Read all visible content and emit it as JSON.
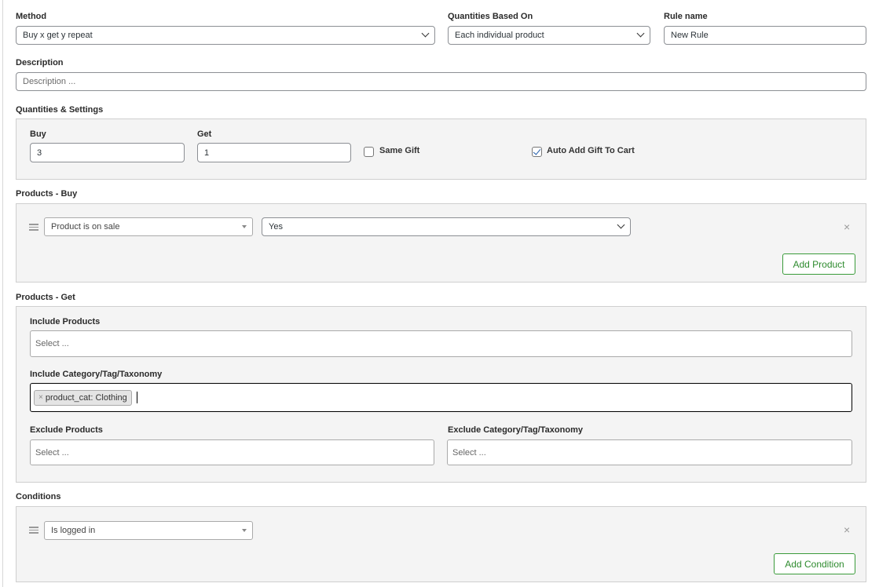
{
  "method": {
    "label": "Method",
    "value": "Buy x get y repeat"
  },
  "quantities_based_on": {
    "label": "Quantities Based On",
    "value": "Each individual product"
  },
  "rule_name": {
    "label": "Rule name",
    "value": "New Rule"
  },
  "description": {
    "label": "Description",
    "placeholder": "Description ..."
  },
  "quantities_settings": {
    "label": "Quantities & Settings",
    "buy_label": "Buy",
    "buy_value": "3",
    "get_label": "Get",
    "get_value": "1",
    "same_gift_label": "Same Gift",
    "same_gift_checked": false,
    "auto_add_label": "Auto Add Gift To Cart",
    "auto_add_checked": true
  },
  "products_buy": {
    "label": "Products - Buy",
    "condition_type": "Product is on sale",
    "condition_value": "Yes",
    "remove_symbol": "×",
    "add_button": "Add Product"
  },
  "products_get": {
    "label": "Products - Get",
    "include_products_label": "Include Products",
    "include_products_placeholder": "Select ...",
    "include_category_label": "Include Category/Tag/Taxonomy",
    "include_category_chip": "product_cat: Clothing",
    "chip_remove": "×",
    "exclude_products_label": "Exclude Products",
    "exclude_products_placeholder": "Select ...",
    "exclude_category_label": "Exclude Category/Tag/Taxonomy",
    "exclude_category_placeholder": "Select ..."
  },
  "conditions": {
    "label": "Conditions",
    "condition_type": "Is logged in",
    "remove_symbol": "×",
    "add_button": "Add Condition"
  },
  "colors": {
    "accent_green": "#2e8b2e",
    "panel_bg": "#f4f4f4",
    "checkbox_tick": "#1e5aa8"
  }
}
